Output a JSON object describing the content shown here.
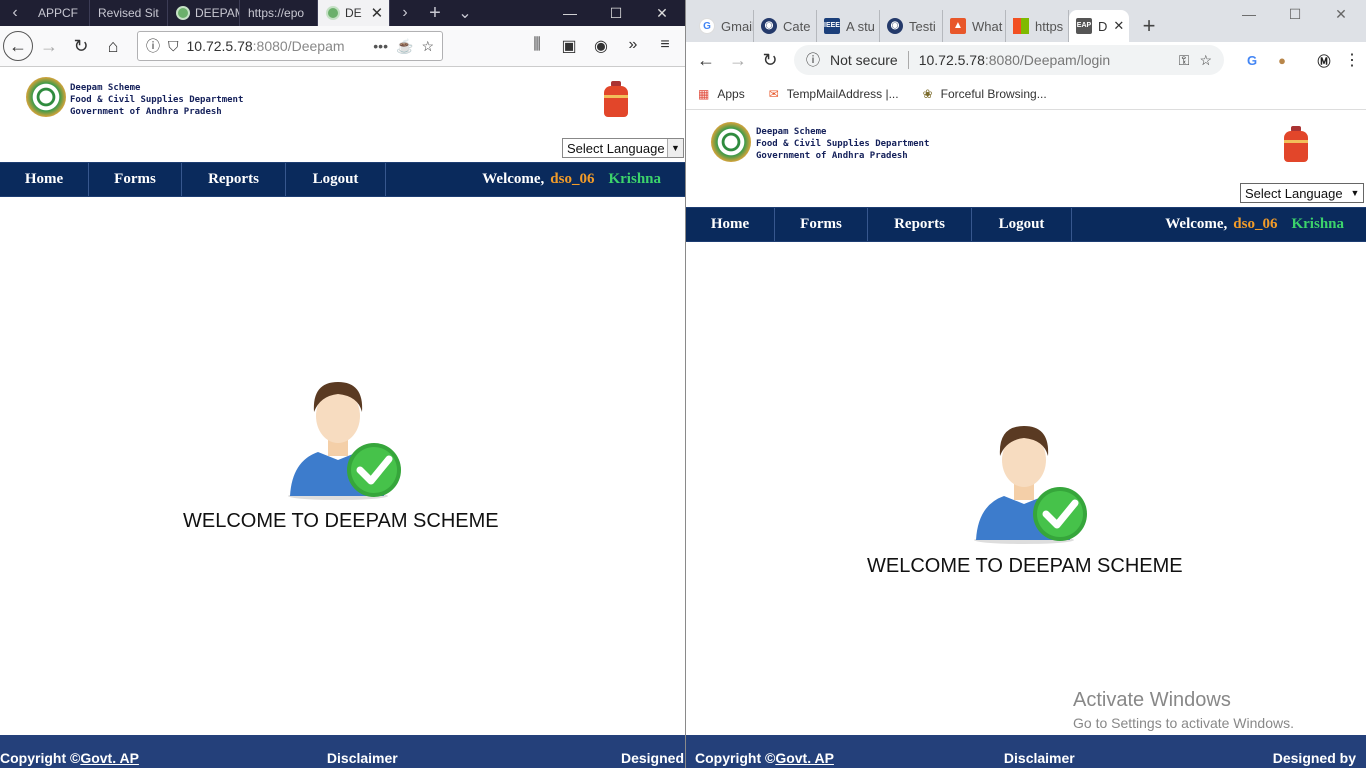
{
  "firefox": {
    "tabs": [
      {
        "label": "APPCF"
      },
      {
        "label": "Revised Sit"
      },
      {
        "label": "DEEPAM"
      },
      {
        "label": "https://epo"
      },
      {
        "label": "DE"
      }
    ],
    "url": {
      "host": "10.72.5.78",
      "rest": ":8080/Deepam"
    },
    "page": {
      "org_lines": [
        "Deepam Scheme",
        "Food & Civil Supplies Department",
        "Government of Andhra Pradesh"
      ],
      "language_select": "Select Language",
      "menu": [
        "Home",
        "Forms",
        "Reports",
        "Logout"
      ],
      "welcome_label": "Welcome,",
      "username": "dso_06",
      "district": "Krishna",
      "welcome_message": "WELCOME TO DEEPAM SCHEME",
      "footer": {
        "copyright": "Copyright ©",
        "govt_link": "Govt. AP",
        "disclaimer": "Disclaimer",
        "designed": "Designed"
      }
    }
  },
  "chrome": {
    "tabs": [
      {
        "label": "Gmail"
      },
      {
        "label": "Cate"
      },
      {
        "label": "A stu"
      },
      {
        "label": "Testi"
      },
      {
        "label": "What"
      },
      {
        "label": "https"
      },
      {
        "label": "D"
      }
    ],
    "url": {
      "security": "Not secure",
      "host": "10.72.5.78",
      "rest": ":8080/Deepam/login"
    },
    "bookmarks": [
      "Apps",
      "TempMailAddress |...",
      "Forceful Browsing..."
    ],
    "page": {
      "org_lines": [
        "Deepam Scheme",
        "Food & Civil Supplies Department",
        "Government of Andhra Pradesh"
      ],
      "language_select": "Select Language",
      "menu": [
        "Home",
        "Forms",
        "Reports",
        "Logout"
      ],
      "welcome_label": "Welcome,",
      "username": "dso_06",
      "district": "Krishna",
      "welcome_message": "WELCOME TO DEEPAM SCHEME",
      "footer": {
        "copyright": "Copyright ©",
        "govt_link": "Govt. AP",
        "disclaimer": "Disclaimer",
        "designed": "Designed by"
      }
    },
    "watermark": {
      "title": "Activate Windows",
      "subtitle": "Go to Settings to activate Windows."
    }
  },
  "colors": {
    "navy": "#0a2a5c",
    "footer": "#24407a",
    "username": "#f39c29",
    "district": "#3cd36b"
  }
}
